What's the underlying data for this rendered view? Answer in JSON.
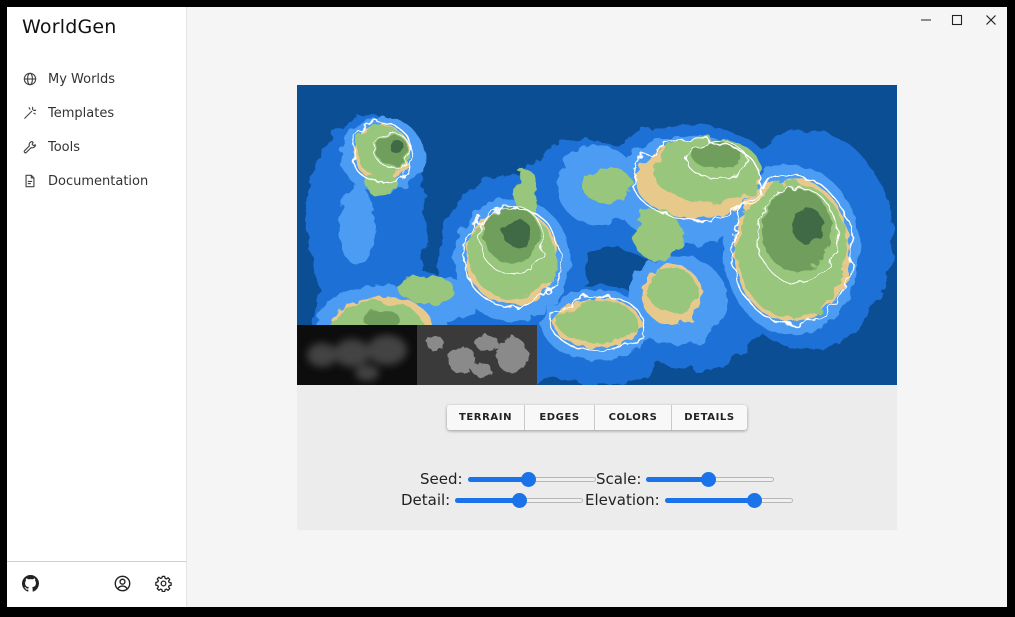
{
  "app": {
    "title": "WorldGen"
  },
  "sidebar": {
    "items": [
      {
        "label": "My Worlds",
        "icon": "globe-icon"
      },
      {
        "label": "Templates",
        "icon": "magic-wand-icon"
      },
      {
        "label": "Tools",
        "icon": "wrench-icon"
      },
      {
        "label": "Documentation",
        "icon": "document-icon"
      }
    ],
    "footer": {
      "icons": [
        "github-icon",
        "user-circle-icon",
        "gear-icon"
      ]
    }
  },
  "window_controls": {
    "icons": [
      "minimize-icon",
      "maximize-icon",
      "close-icon"
    ]
  },
  "map": {
    "colors": {
      "deep_ocean": "#0c4e94",
      "shallow": "#1f6fd6",
      "coast": "#4b9cf2",
      "beach": "#e8c98c",
      "land": "#97c67c",
      "highland": "#6f9e5c",
      "peak": "#3f6a44"
    },
    "thumbnails": [
      "noise-preview",
      "heightmap-preview"
    ]
  },
  "toolbar": {
    "buttons": [
      "TERRAIN",
      "EDGES",
      "COLORS",
      "DETAILS"
    ]
  },
  "controls": {
    "seed": {
      "label": "Seed:",
      "value": 0.47
    },
    "scale": {
      "label": "Scale:",
      "value": 0.48
    },
    "detail": {
      "label": "Detail:",
      "value": 0.5
    },
    "elevation": {
      "label": "Elevation:",
      "value": 0.7
    }
  },
  "accent_color": "#1a73e8"
}
